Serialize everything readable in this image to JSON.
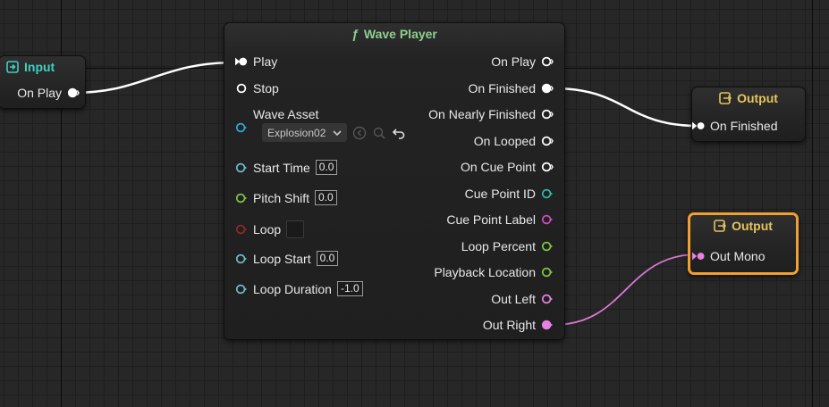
{
  "nodes": {
    "input": {
      "title": "Input",
      "pin_on_play": "On Play"
    },
    "wave_player": {
      "title": "Wave Player",
      "title_glyph": "ƒ",
      "inputs": {
        "play": "Play",
        "stop": "Stop",
        "wave_asset": "Wave Asset",
        "wave_asset_value": "Explosion02",
        "start_time": "Start Time",
        "start_time_value": "0.0",
        "pitch_shift": "Pitch Shift",
        "pitch_shift_value": "0.0",
        "loop": "Loop",
        "loop_start": "Loop Start",
        "loop_start_value": "0.0",
        "loop_duration": "Loop Duration",
        "loop_duration_value": "-1.0"
      },
      "outputs": {
        "on_play": "On Play",
        "on_finished": "On Finished",
        "on_nearly_finished": "On Nearly Finished",
        "on_looped": "On Looped",
        "on_cue_point": "On Cue Point",
        "cue_point_id": "Cue Point ID",
        "cue_point_label": "Cue Point Label",
        "loop_percent": "Loop Percent",
        "playback_location": "Playback Location",
        "out_left": "Out Left",
        "out_right": "Out Right"
      }
    },
    "output_finished": {
      "title": "Output",
      "pin": "On Finished"
    },
    "output_mono": {
      "title": "Output",
      "pin": "Out Mono"
    }
  },
  "colors": {
    "input_title": "#3fd0c0",
    "wave_title": "#8fcf8f",
    "output_title": "#e4c45c",
    "selection": "#f0a030",
    "pin_float": "#6fb9c9",
    "pin_bool": "#8b2a2a",
    "pin_int": "#7cc544",
    "pin_string": "#d04ac2",
    "pin_asset": "#2ea8d8",
    "pin_audio": "#e880e0",
    "pin_trigger": "#ffffff",
    "pin_int_teal": "#32b8a0"
  },
  "icons": [
    "input-icon",
    "function-icon",
    "output-icon",
    "browse-icon",
    "search-icon",
    "reset-icon",
    "chevron-down-icon"
  ]
}
